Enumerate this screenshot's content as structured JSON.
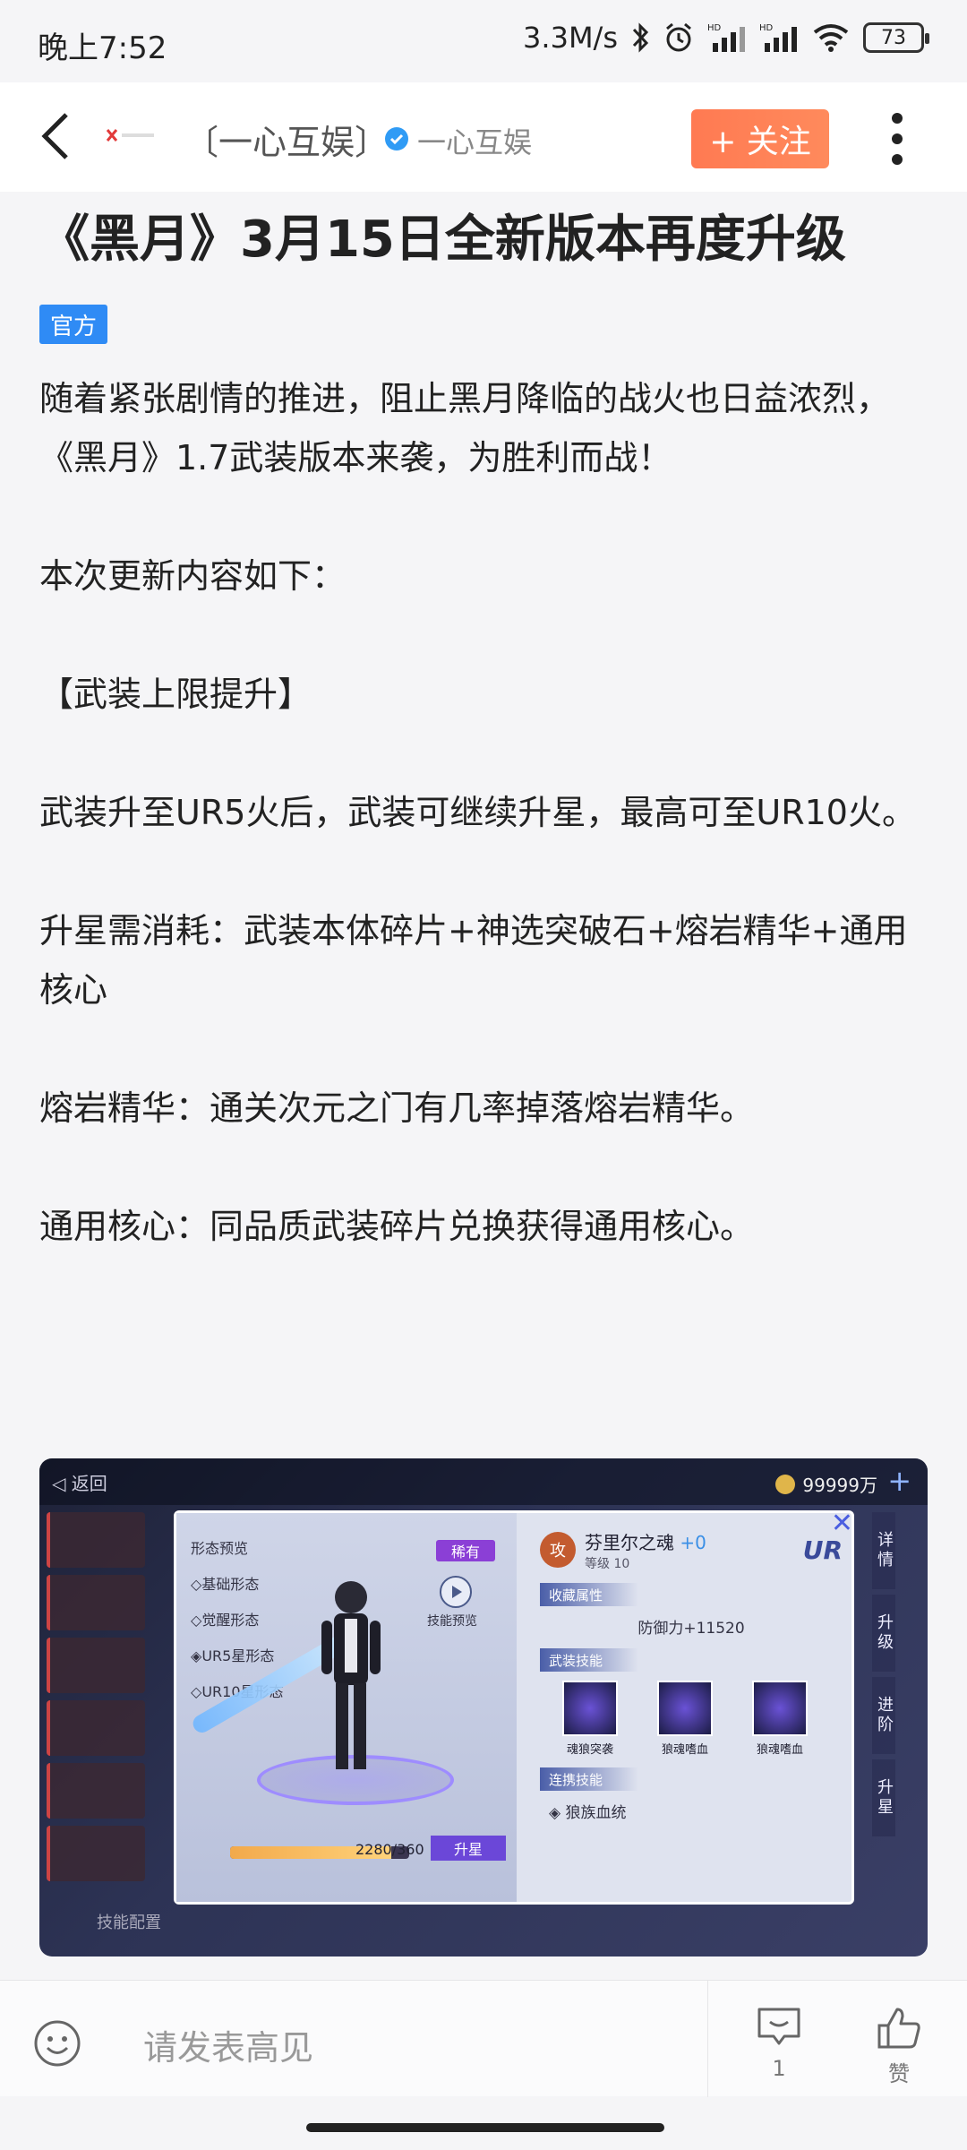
{
  "status": {
    "time": "晚上7:52",
    "speed": "3.3M/s",
    "battery": "73",
    "network_label": "HD"
  },
  "nav": {
    "account_name": "〔一心互娱〕",
    "account_sub": "一心互娱",
    "follow_label": "+ 关注"
  },
  "article": {
    "title": "《黑月》3月15日全新版本再度升级",
    "badge": "官方",
    "paragraphs": [
      "随着紧张剧情的推进，阻止黑月降临的战火也日益浓烈，《黑月》1.7武装版本来袭，为胜利而战！",
      "本次更新内容如下：",
      "【武装上限提升】",
      "武装升至UR5火后，武装可继续升星，最高可至UR10火。",
      "升星需消耗：武装本体碎片+神选突破石+熔岩精华+通用核心",
      "熔岩精华：通关次元之门有几率掉落熔岩精华。",
      "通用核心：同品质武装碎片兑换获得通用核心。"
    ]
  },
  "game_image": {
    "back_label": "返回",
    "coins": "99999万",
    "menu_title": "形态预览",
    "menu_items": [
      "基础形态",
      "觉醒形态",
      "UR5星形态",
      "UR10星形态"
    ],
    "tag": "稀有",
    "skill_preview_label": "技能预览",
    "progress_text": "2280/360",
    "progress_fraction": 0.9,
    "upstar_label": "升星",
    "type_icon": "攻",
    "weapon_name": "芬里尔之魂",
    "weapon_plus": "+0",
    "level_label": "等级 10",
    "rarity": "UR",
    "section_attrs": "收藏属性",
    "stat": "防御力+11520",
    "section_skills": "武装技能",
    "skills": [
      "魂狼突袭",
      "狼魂嗜血",
      "狼魂嗜血"
    ],
    "section_combo": "连携技能",
    "combo_skill": "狼族血统",
    "right_tabs": [
      "详情",
      "升级",
      "进阶",
      "升星"
    ],
    "bottom_label": "技能配置"
  },
  "bottom": {
    "comment_placeholder": "请发表高见",
    "comment_count": "1",
    "like_label": "赞"
  }
}
